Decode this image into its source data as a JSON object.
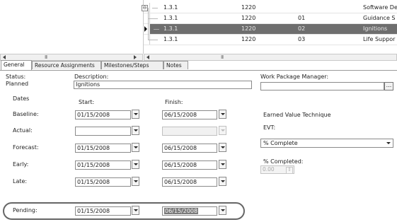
{
  "grid": {
    "rows": [
      {
        "wbs": "1.3.1",
        "col2": "1220",
        "col3": "",
        "name": "Software De",
        "expander": "⊖",
        "selected": false
      },
      {
        "wbs": "1.3.1",
        "col2": "1220",
        "col3": "01",
        "name": "Guidance S",
        "expander": "",
        "selected": false
      },
      {
        "wbs": "1.3.1",
        "col2": "1220",
        "col3": "02",
        "name": "Ignitions",
        "expander": "",
        "selected": true
      },
      {
        "wbs": "1.3.1",
        "col2": "1220",
        "col3": "03",
        "name": "Life Suppor",
        "expander": "",
        "selected": false
      }
    ]
  },
  "scroll": {
    "thumb_glyph": "III"
  },
  "tabs": [
    {
      "label": "General",
      "active": true
    },
    {
      "label": "Resource Assignments",
      "active": false
    },
    {
      "label": "Milestones/Steps",
      "active": false
    },
    {
      "label": "Notes",
      "active": false
    }
  ],
  "form": {
    "status_label": "Status:",
    "status_value": "Planned",
    "description_label": "Description:",
    "description_value": "Ignitions",
    "wpm_label": "Work Package Manager:",
    "wpm_value": "",
    "wpm_button": "...",
    "dates_header": "Dates",
    "start_header": "Start:",
    "finish_header": "Finish:",
    "date_rows": [
      {
        "label": "Baseline:",
        "start": "01/15/2008",
        "finish": "06/15/2008",
        "finish_disabled": false,
        "finish_selected": false
      },
      {
        "label": "Actual:",
        "start": "",
        "finish": "",
        "finish_disabled": true,
        "finish_selected": false
      },
      {
        "label": "Forecast:",
        "start": "01/15/2008",
        "finish": "06/15/2008",
        "finish_disabled": false,
        "finish_selected": false
      },
      {
        "label": "Early:",
        "start": "01/15/2008",
        "finish": "06/15/2008",
        "finish_disabled": false,
        "finish_selected": false
      },
      {
        "label": "Late:",
        "start": "01/15/2008",
        "finish": "06/15/2008",
        "finish_disabled": false,
        "finish_selected": false
      },
      {
        "label": "Pending:",
        "start": "01/15/2008",
        "finish": "06/15/2008",
        "finish_disabled": false,
        "finish_selected": true
      }
    ],
    "evt_header": "Earned Value Technique",
    "evt_label": "EVT:",
    "evt_value": "% Complete",
    "pct_label": "% Completed:",
    "pct_value": "0.00",
    "spin_glyph": "⇕"
  },
  "colors": {
    "selected_row": "#6e6e6e",
    "highlight_oval": "#666666"
  }
}
